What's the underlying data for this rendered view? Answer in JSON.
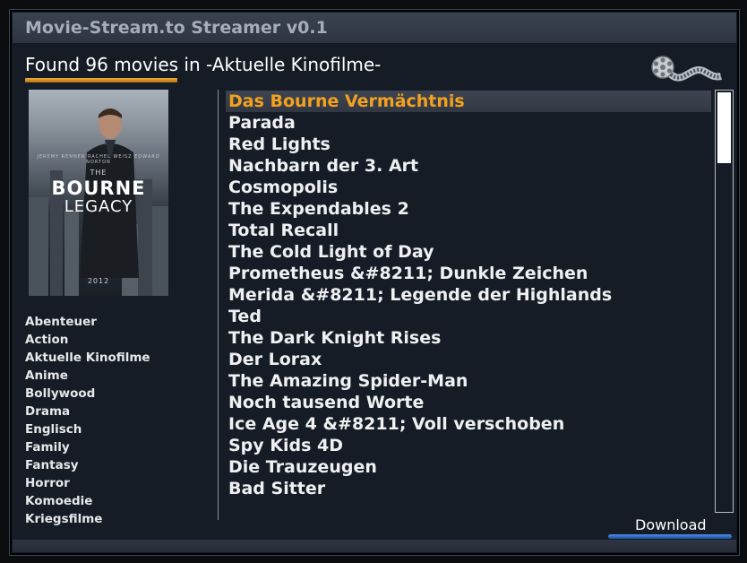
{
  "window": {
    "title": "Movie-Stream.to Streamer v0.1"
  },
  "heading": "Found 96 movies in -Aktuelle Kinofilme-",
  "poster": {
    "names": "JEREMY RENNER   RACHEL WEISZ   EDWARD NORTON",
    "small_title": "THE",
    "title_line1": "BOURNE",
    "title_line2": "LEGACY",
    "year": "2012"
  },
  "categories": [
    "Abenteuer",
    "Action",
    "Aktuelle Kinofilme",
    "Anime",
    "Bollywood",
    "Drama",
    "Englisch",
    "Family",
    "Fantasy",
    "Horror",
    "Komoedie",
    "Kriegsfilme"
  ],
  "movies": [
    "Das Bourne Vermächtnis",
    "Parada",
    "Red Lights",
    "Nachbarn der 3. Art",
    "Cosmopolis",
    "The Expendables 2",
    "Total Recall",
    "The Cold Light of Day",
    "Prometheus &#8211; Dunkle Zeichen",
    "Merida &#8211; Legende der Highlands",
    "Ted",
    "The Dark Knight Rises",
    "Der Lorax",
    "The Amazing Spider-Man",
    "Noch tausend Worte",
    "Ice Age 4 &#8211; Voll verschoben",
    "Spy Kids 4D",
    "Die Trauzeugen",
    "Bad Sitter"
  ],
  "selected_movie_index": 0,
  "buttons": {
    "download_label": "Download"
  },
  "colors": {
    "accent_orange": "#f4a21e",
    "accent_blue": "#3a78d6",
    "background": "#151c26"
  },
  "icons": {
    "film": "film-reel-icon"
  }
}
